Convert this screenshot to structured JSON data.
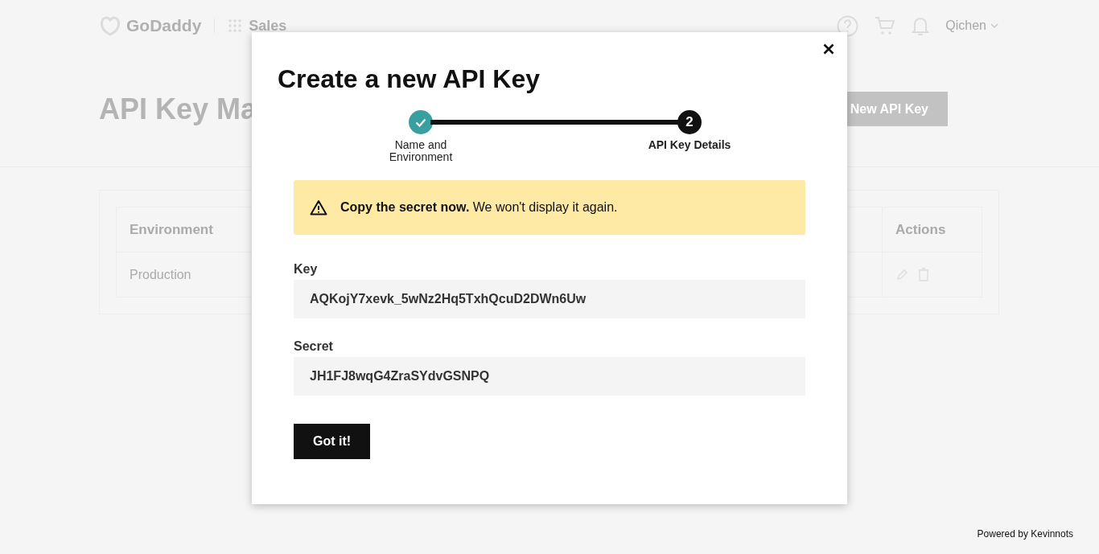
{
  "header": {
    "logo": "GoDaddy",
    "app": "Sales",
    "user": "Qichen"
  },
  "page": {
    "title": "API Key Ma",
    "create_button": "New API Key",
    "table": {
      "columns": [
        "Environment",
        "Actions"
      ],
      "rows": [
        {
          "environment": "Production"
        }
      ]
    }
  },
  "modal": {
    "title": "Create a new API Key",
    "steps": [
      {
        "label": "Name and Environment",
        "complete": true,
        "selected": false
      },
      {
        "number": "2",
        "label": "API Key Details",
        "complete": false,
        "selected": true
      }
    ],
    "alert": "**Copy the secret now.** We won't display it again.",
    "fields": [
      {
        "label": "Key",
        "value": "AQKojY7xevk_5wNz2Hq5TxhQcuD2DWn6Uw"
      },
      {
        "label": "Secret",
        "value": "JH1FJ8wqG4ZraSYdvGSNPQ"
      }
    ],
    "button": "Got it!"
  },
  "footer": "Powered by Kevinnots"
}
